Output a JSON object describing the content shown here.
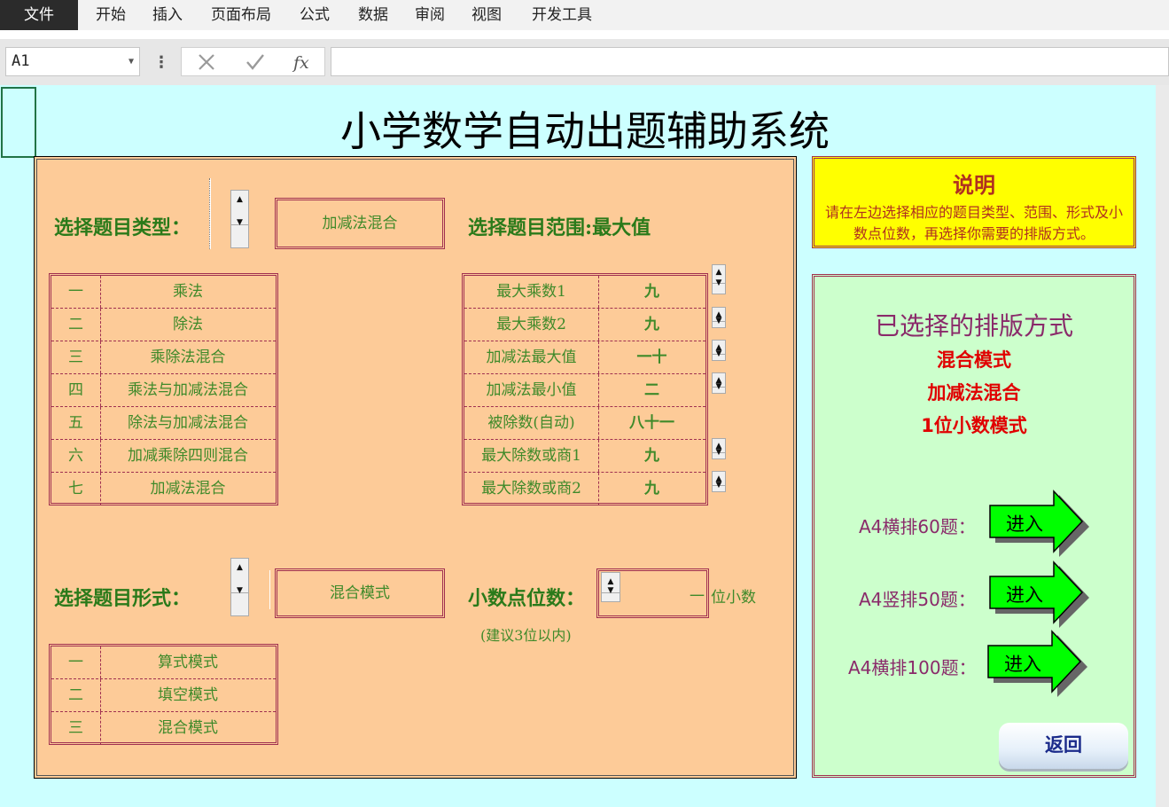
{
  "ribbon": {
    "file": "文件",
    "tabs": [
      "开始",
      "插入",
      "页面布局",
      "公式",
      "数据",
      "审阅",
      "视图",
      "开发工具"
    ]
  },
  "formula_bar": {
    "name_box": "A1",
    "value": ""
  },
  "title": "小学数学自动出题辅助系统",
  "type_section": {
    "label": "选择题目类型：",
    "selected": "加减法混合",
    "items": [
      {
        "no": "一",
        "name": "乘法"
      },
      {
        "no": "二",
        "name": "除法"
      },
      {
        "no": "三",
        "name": "乘除法混合"
      },
      {
        "no": "四",
        "name": "乘法与加减法混合"
      },
      {
        "no": "五",
        "name": "除法与加减法混合"
      },
      {
        "no": "六",
        "name": "加减乘除四则混合"
      },
      {
        "no": "七",
        "name": "加减法混合"
      }
    ]
  },
  "range_section": {
    "label": "选择题目范围:最大值",
    "items": [
      {
        "name": "最大乘数1",
        "value": "九"
      },
      {
        "name": "最大乘数2",
        "value": "九"
      },
      {
        "name": "加减法最大值",
        "value": "一十"
      },
      {
        "name": "加减法最小值",
        "value": "二"
      },
      {
        "name": "被除数(自动)",
        "value": "八十一"
      },
      {
        "name": "最大除数或商1",
        "value": "九"
      },
      {
        "name": "最大除数或商2",
        "value": "九"
      }
    ]
  },
  "form_section": {
    "label": "选择题目形式：",
    "selected": "混合模式",
    "items": [
      {
        "no": "一",
        "name": "算式模式"
      },
      {
        "no": "二",
        "name": "填空模式"
      },
      {
        "no": "三",
        "name": "混合模式"
      }
    ]
  },
  "decimal_section": {
    "label": "小数点位数：",
    "value": "一",
    "suffix": "位小数",
    "hint": "(建议3位以内)"
  },
  "info": {
    "title": "说明",
    "text": "请在左边选择相应的题目类型、范围、形式及小数点位数，再选择你需要的排版方式。"
  },
  "selected_panel": {
    "title": "已选择的排版方式",
    "mode": "混合模式",
    "type": "加减法混合",
    "decimal": "1位小数模式",
    "layouts": [
      {
        "label": "A4横排60题：",
        "button": "进入"
      },
      {
        "label": "A4竖排50题：",
        "button": "进入"
      },
      {
        "label": "A4横排100题：",
        "button": "进入"
      }
    ],
    "back": "返回"
  },
  "colors": {
    "panel_bg": "#fdcb98",
    "sheet_bg": "#ccffff",
    "info_bg": "#ffff00",
    "selected_bg": "#ccffcc",
    "label_green": "#2a7a1a",
    "accent_red": "#e00000",
    "arrow_green": "#00ff00"
  }
}
